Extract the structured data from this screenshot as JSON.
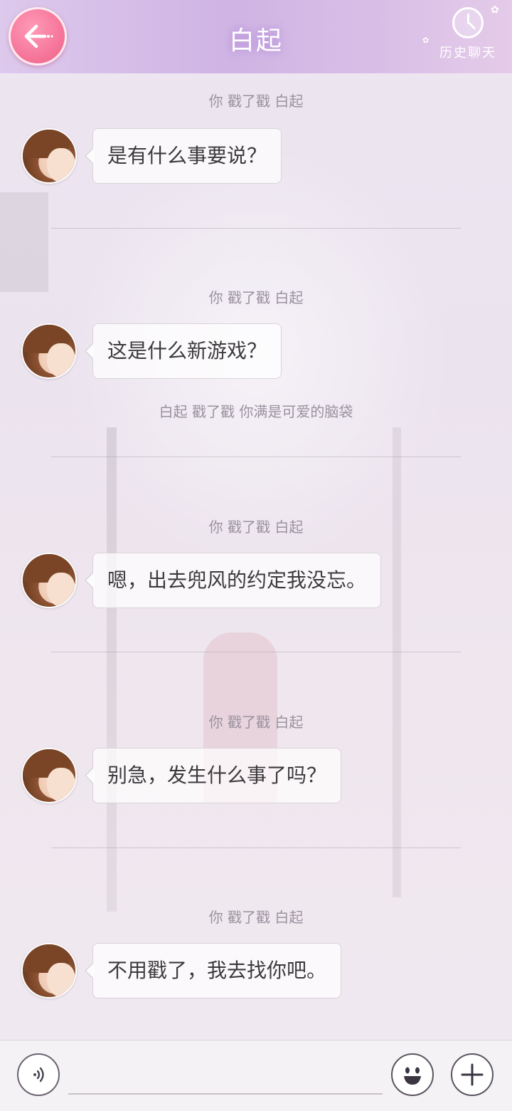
{
  "header": {
    "title": "白起",
    "back_icon": "arrow-left-icon",
    "history": {
      "label": "历史聊天",
      "icon": "clock-icon"
    }
  },
  "chat": {
    "items": [
      {
        "notice": "你 戳了戳 白起",
        "message": "是有什么事要说？",
        "sender": "白起"
      },
      {
        "notice": "你 戳了戳 白起",
        "message": "这是什么新游戏？",
        "sender": "白起",
        "reply_notice": "白起 戳了戳 你满是可爱的脑袋"
      },
      {
        "notice": "你 戳了戳 白起",
        "message": "嗯，出去兜风的约定我没忘。",
        "sender": "白起"
      },
      {
        "notice": "你 戳了戳 白起",
        "message": "别急，发生什么事了吗？",
        "sender": "白起"
      },
      {
        "notice": "你 戳了戳 白起",
        "message": "不用戳了，我去找你吧。",
        "sender": "白起"
      }
    ]
  },
  "input_bar": {
    "voice_icon": "voice-icon",
    "input_value": "",
    "emoji_icon": "emoji-icon",
    "plus_icon": "plus-icon"
  },
  "colors": {
    "header_gradient_start": "#ddc9ec",
    "header_gradient_end": "#e5cbe9",
    "back_button": "#f47196",
    "notice_text": "#9a929e",
    "bubble_text": "#3d3a3d"
  }
}
